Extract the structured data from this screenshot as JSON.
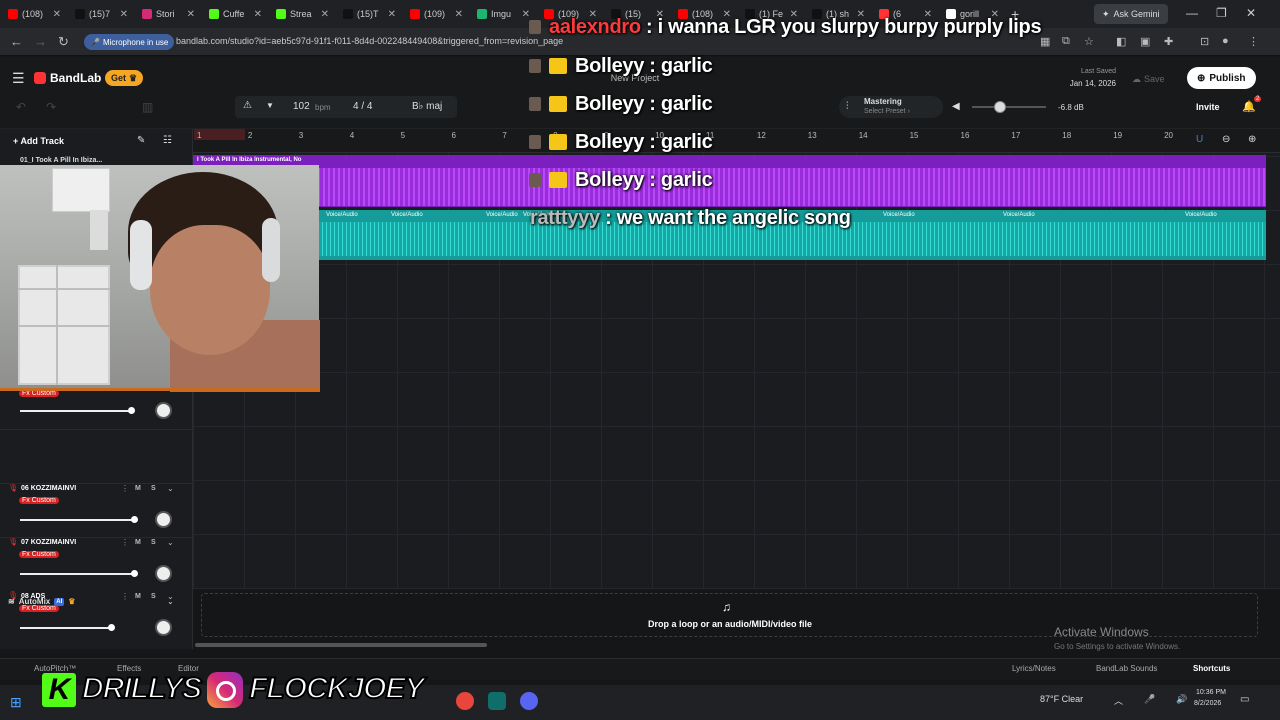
{
  "browser": {
    "tabs": [
      {
        "label": "(108)",
        "color": "#ff0000"
      },
      {
        "label": "(15)7",
        "color": "#111111"
      },
      {
        "label": "Stori",
        "color": "#d62976"
      },
      {
        "label": "Cuffe",
        "color": "#53fc18"
      },
      {
        "label": "Strea",
        "color": "#53fc18"
      },
      {
        "label": "(15)T",
        "color": "#111111"
      },
      {
        "label": "(109)",
        "color": "#ff0000"
      },
      {
        "label": "Imgu",
        "color": "#1bb76e"
      },
      {
        "label": "(109)",
        "color": "#ff0000"
      },
      {
        "label": "(15)",
        "color": "#111111"
      },
      {
        "label": "(108)",
        "color": "#ff0000"
      },
      {
        "label": "(1) Fe",
        "color": "#111111"
      },
      {
        "label": "(1) sh",
        "color": "#111111"
      },
      {
        "label": "(6",
        "color": "#ff3333"
      },
      {
        "label": "gorill",
        "color": "#ffffff"
      }
    ],
    "new_tab": "+",
    "ask_gemini": "Ask Gemini",
    "mic_pill": "Microphone in use",
    "url": "bandlab.com/studio?id=aeb5c97d-91f1-f011-8d4d-002248449408&triggered_from=revision_page"
  },
  "app": {
    "logo": "BandLab",
    "get": "Get",
    "project_title": "New Project",
    "last_saved_label": "Last Saved",
    "last_saved_date": "Jan 14, 2026",
    "save": "Save",
    "publish": "Publish"
  },
  "transport": {
    "bpm": "102",
    "bpm_label": "bpm",
    "time_sig": "4 / 4",
    "key": "B♭ maj",
    "mastering": "Mastering",
    "preset": "Select Preset ›",
    "db": "-6.8 dB",
    "invite": "Invite",
    "notif_count": "2"
  },
  "ruler": [
    "1",
    "2",
    "3",
    "4",
    "5",
    "6",
    "7",
    "8",
    "9",
    "10",
    "11",
    "12",
    "13",
    "14",
    "15",
    "16",
    "17",
    "18",
    "19",
    "20"
  ],
  "tracks_panel": {
    "add_track": "Add Track",
    "track01_name": "01_I Took A Pill In Ibiza...",
    "tracks": [
      {
        "name": "",
        "fx": "Fx Custom",
        "vol": 0.85
      },
      {
        "name": "06  KOZZIMAINVI",
        "fx": "Fx Custom",
        "vol": 0.88
      },
      {
        "name": "07  KOZZIMAINVI",
        "fx": "Fx Custom",
        "vol": 0.88
      },
      {
        "name": "08  ADS",
        "fx": "Fx Custom",
        "vol": 0.7
      }
    ],
    "m": "M",
    "s": "S",
    "automix": "AutoMix",
    "ai": "AI"
  },
  "clips": {
    "clip1_title": "I Took A Pill In Ibiza Instrumental, No",
    "voice_label": "Voice/Audio"
  },
  "drop": "Drop a loop or an audio/MIDI/video file",
  "activate_title": "Activate Windows",
  "activate_sub": "Go to Settings to activate Windows.",
  "bottom": {
    "autopitch": "AutoPitch™",
    "effects": "Effects",
    "editor": "Editor",
    "lyrics": "Lyrics/Notes",
    "sounds": "BandLab Sounds",
    "shortcuts": "Shortcuts"
  },
  "taskbar": {
    "weather": "87°F  Clear",
    "time": "10:36 PM",
    "date": "8/2/2026"
  },
  "overlay": {
    "chat": [
      {
        "user": "aalexndro",
        "msg": " : i wanna LGR you slurpy burpy purply lips"
      },
      {
        "user": "Bolleyy",
        "msg": " : garlic"
      },
      {
        "user": "Bolleyy",
        "msg": " : garlic"
      },
      {
        "user": "Bolleyy",
        "msg": " : garlic"
      },
      {
        "user": "Bolleyy",
        "msg": " : garlic"
      },
      {
        "user": "ratttyyy",
        "msg": " : we want the angelic song"
      }
    ],
    "social1": "DRILLYS",
    "social2": "FLOCKJOEY"
  }
}
